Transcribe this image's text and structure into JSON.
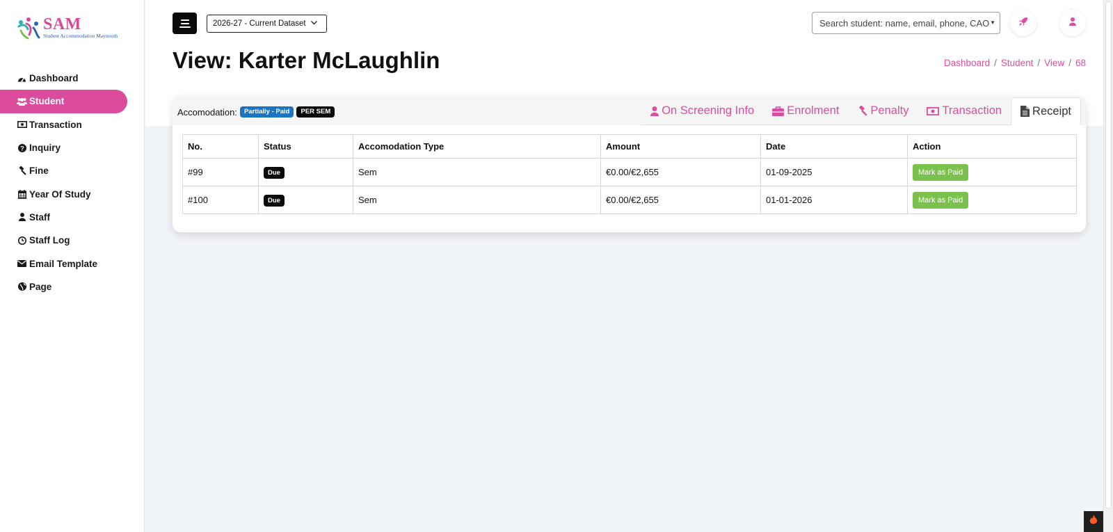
{
  "logo": {
    "title": "SAM",
    "subtitle": "Student Accommodation Maynooth"
  },
  "sidebar": {
    "items": [
      {
        "label": "Dashboard",
        "icon": "dashboard-icon",
        "active": false
      },
      {
        "label": "Student",
        "icon": "users-icon",
        "active": true
      },
      {
        "label": "Transaction",
        "icon": "money-icon",
        "active": false
      },
      {
        "label": "Inquiry",
        "icon": "question-icon",
        "active": false
      },
      {
        "label": "Fine",
        "icon": "gavel-icon",
        "active": false
      },
      {
        "label": "Year Of Study",
        "icon": "calendar-icon",
        "active": false
      },
      {
        "label": "Staff",
        "icon": "user-icon",
        "active": false
      },
      {
        "label": "Staff Log",
        "icon": "clock-icon",
        "active": false
      },
      {
        "label": "Email Template",
        "icon": "envelope-icon",
        "active": false
      },
      {
        "label": "Page",
        "icon": "globe-icon",
        "active": false
      }
    ]
  },
  "header": {
    "dataset": "2026-27 - Current Dataset",
    "search_placeholder": "Search student: name, email, phone, CAO"
  },
  "page": {
    "title": "View: Karter McLaughlin",
    "breadcrumbs": [
      "Dashboard",
      "Student",
      "View",
      "68"
    ]
  },
  "card": {
    "accommodation_label": "Accomodation:",
    "badges": {
      "payment": "Partially - Paid",
      "plan": "PER SEM"
    },
    "tabs": [
      {
        "label": "On Screening Info",
        "icon": "user-icon",
        "active": false
      },
      {
        "label": "Enrolment",
        "icon": "briefcase-icon",
        "active": false
      },
      {
        "label": "Penalty",
        "icon": "gavel-icon",
        "active": false
      },
      {
        "label": "Transaction",
        "icon": "money-icon",
        "active": false
      },
      {
        "label": "Receipt",
        "icon": "file-icon",
        "active": true
      }
    ],
    "table": {
      "columns": [
        "No.",
        "Status",
        "Accomodation Type",
        "Amount",
        "Date",
        "Action"
      ],
      "rows": [
        {
          "no": "#99",
          "status": "Due",
          "type": "Sem",
          "amount": "€0.00/€2,655",
          "date": "01-09-2025",
          "action": "Mark as Paid"
        },
        {
          "no": "#100",
          "status": "Due",
          "type": "Sem",
          "amount": "€0.00/€2,655",
          "date": "01-01-2026",
          "action": "Mark as Paid"
        }
      ]
    }
  },
  "colors": {
    "accent": "#db4d9c",
    "badge_blue": "#1a75c4",
    "button_green": "#7cc14e"
  }
}
